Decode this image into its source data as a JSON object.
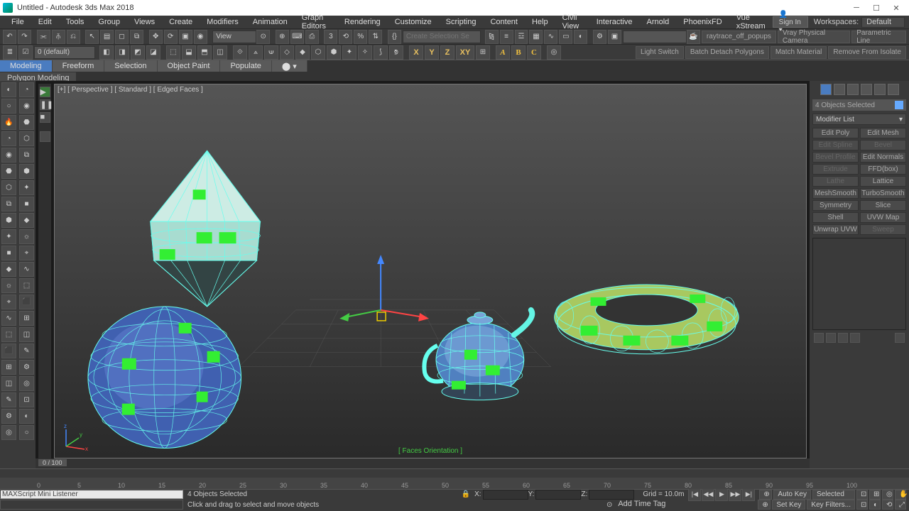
{
  "title": "Untitled - Autodesk 3ds Max 2018",
  "signin": "Sign In",
  "workspaces_label": "Workspaces:",
  "workspace": "Default",
  "menus": [
    "File",
    "Edit",
    "Tools",
    "Group",
    "Views",
    "Create",
    "Modifiers",
    "Animation",
    "Graph Editors",
    "Rendering",
    "Customize",
    "Scripting",
    "Content",
    "Help",
    "Civil View",
    "Interactive",
    "Arnold",
    "PhoenixFD",
    "Vue xStream"
  ],
  "selection_set": "0 (default)",
  "view_label": "View",
  "create_set_placeholder": "Create Selection Se",
  "right_chips": [
    "Light Switch",
    "Batch Detach Polygons",
    "Match Material",
    "Remove From Isolate"
  ],
  "top_chips": [
    "raytrace_off_popups",
    "Vray Physical Camera",
    "Parametric Line"
  ],
  "axes": [
    "X",
    "Y",
    "Z",
    "XY"
  ],
  "ribbon_tabs": [
    "Modeling",
    "Freeform",
    "Selection",
    "Object Paint",
    "Populate"
  ],
  "ribbon_sub": "Polygon Modeling",
  "viewport_label": "[+] [ Perspective ] [ Standard ] [ Edged Faces ]",
  "viewport_hint": "[ Faces Orientation ]",
  "selection_status": "4 Objects Selected",
  "modifier_list_label": "Modifier List",
  "modifier_buttons": [
    [
      "Edit Poly",
      "Edit Mesh"
    ],
    [
      "Edit Spline",
      "Bevel"
    ],
    [
      "Bevel Profile",
      "Edit Normals"
    ],
    [
      "Extrude",
      "FFD(box)"
    ],
    [
      "Lathe",
      "Lattice"
    ],
    [
      "MeshSmooth",
      "TurboSmooth"
    ],
    [
      "Symmetry",
      "Slice"
    ],
    [
      "Shell",
      "UVW Map"
    ],
    [
      "Unwrap UVW",
      "Sweep"
    ]
  ],
  "frames": "0 / 100",
  "ruler_ticks": [
    "0",
    "5",
    "10",
    "15",
    "20",
    "25",
    "30",
    "35",
    "40",
    "45",
    "50",
    "55",
    "60",
    "65",
    "70",
    "75",
    "80",
    "85",
    "90",
    "95",
    "100"
  ],
  "maxscript_label": "MAXScript Mini Listener",
  "status_msg1": "4 Objects Selected",
  "status_msg2": "Click and drag to select and move objects",
  "coord_labels": [
    "X:",
    "Y:",
    "Z:"
  ],
  "grid_label": "Grid = 10.0m",
  "addtimetag": "Add Time Tag",
  "autokey": "Auto Key",
  "setkey": "Set Key",
  "selected_key": "Selected",
  "keyfilters": "Key Filters..."
}
